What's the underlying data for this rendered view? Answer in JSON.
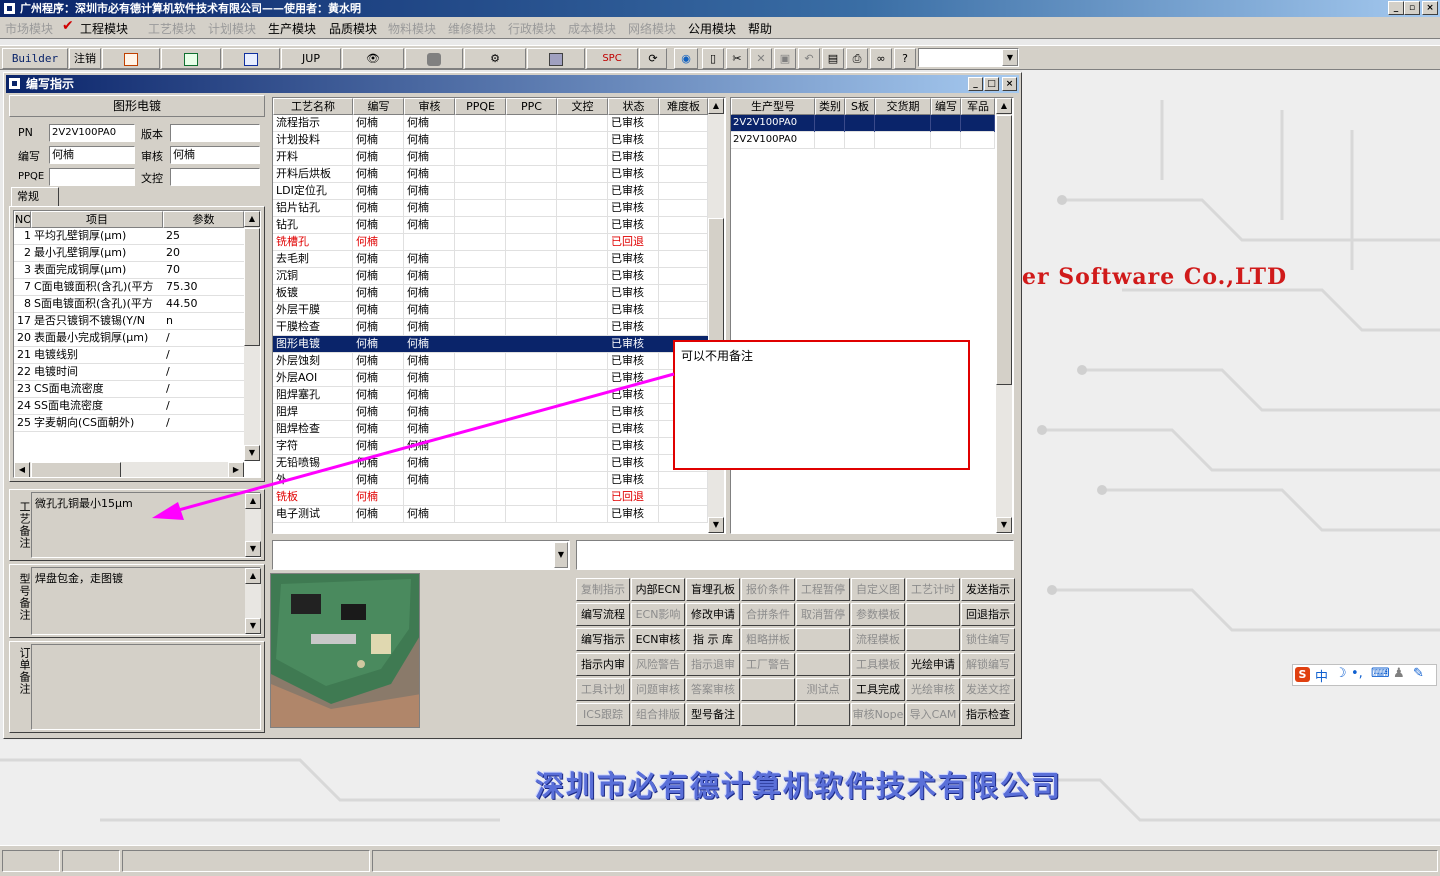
{
  "app": {
    "title": "广州程序：深圳市必有德计算机软件技术有限公司——使用者：黄水明"
  },
  "menu": {
    "items": [
      {
        "label": "市场模块",
        "enabled": false
      },
      {
        "label": "工程模块",
        "enabled": true,
        "checked": true
      },
      {
        "label": "工艺模块",
        "enabled": false
      },
      {
        "label": "计划模块",
        "enabled": false
      },
      {
        "label": "生产模块",
        "enabled": true
      },
      {
        "label": "品质模块",
        "enabled": true
      },
      {
        "label": "物料模块",
        "enabled": false
      },
      {
        "label": "维修模块",
        "enabled": false
      },
      {
        "label": "行政模块",
        "enabled": false
      },
      {
        "label": "成本模块",
        "enabled": false
      },
      {
        "label": "网络模块",
        "enabled": false
      },
      {
        "label": "公用模块",
        "enabled": true
      },
      {
        "label": "帮助",
        "enabled": true
      }
    ]
  },
  "toolbar": {
    "builder": "Builder",
    "logout": "注销",
    "jup": "JUP",
    "spc": "SPC"
  },
  "window": {
    "title": "编写指示",
    "process_name": "图形电镀",
    "form": {
      "pn_label": "PN",
      "pn_value": "2V2V100PA0",
      "version_label": "版本",
      "version_value": "",
      "author_label": "编写",
      "author_value": "何楠",
      "review_label": "审核",
      "review_value": "何楠",
      "ppqe_label": "PPQE",
      "ppqe_value": "",
      "doc_label": "文控",
      "doc_value": ""
    },
    "tab": "常规",
    "params": {
      "headers": [
        "NO",
        "项目",
        "参数"
      ],
      "rows": [
        [
          "1",
          "平均孔壁铜厚(μm)",
          "25"
        ],
        [
          "2",
          "最小孔壁铜厚(μm)",
          "20"
        ],
        [
          "3",
          "表面完成铜厚(μm)",
          "70"
        ],
        [
          "7",
          "C面电镀面积(含孔)(平方",
          "75.30"
        ],
        [
          "8",
          "S面电镀面积(含孔)(平方",
          "44.50"
        ],
        [
          "17",
          "是否只镀铜不镀锡(Y/N",
          "n"
        ],
        [
          "20",
          "表面最小完成铜厚(μm)",
          "/"
        ],
        [
          "21",
          "电镀线别",
          "/"
        ],
        [
          "22",
          "电镀时间",
          "/"
        ],
        [
          "23",
          "CS面电流密度",
          "/"
        ],
        [
          "24",
          "SS面电流密度",
          "/"
        ],
        [
          "25",
          "字麦朝向(CS面朝外)",
          "/"
        ]
      ]
    },
    "memos": {
      "process_label": "工艺备注",
      "process_text": "微孔孔铜最小15μm",
      "model_label": "型号备注",
      "model_text": "焊盘包金，走图镀",
      "order_label": "订单备注",
      "order_text": ""
    },
    "process_table": {
      "headers": [
        "工艺名称",
        "编写",
        "审核",
        "PPQE",
        "PPC",
        "文控",
        "状态",
        "难度板"
      ],
      "rows": [
        {
          "name": "流程指示",
          "author": "何楠",
          "reviewer": "何楠",
          "status": "已审核"
        },
        {
          "name": "计划投料",
          "author": "何楠",
          "reviewer": "何楠",
          "status": "已审核"
        },
        {
          "name": "开料",
          "author": "何楠",
          "reviewer": "何楠",
          "status": "已审核"
        },
        {
          "name": "开料后烘板",
          "author": "何楠",
          "reviewer": "何楠",
          "status": "已审核"
        },
        {
          "name": "LDI定位孔",
          "author": "何楠",
          "reviewer": "何楠",
          "status": "已审核"
        },
        {
          "name": "铝片钻孔",
          "author": "何楠",
          "reviewer": "何楠",
          "status": "已审核"
        },
        {
          "name": "钻孔",
          "author": "何楠",
          "reviewer": "何楠",
          "status": "已审核"
        },
        {
          "name": "铣槽孔",
          "author": "何楠",
          "reviewer": "",
          "status": "已回退",
          "returned": true
        },
        {
          "name": "去毛刺",
          "author": "何楠",
          "reviewer": "何楠",
          "status": "已审核"
        },
        {
          "name": "沉铜",
          "author": "何楠",
          "reviewer": "何楠",
          "status": "已审核"
        },
        {
          "name": "板镀",
          "author": "何楠",
          "reviewer": "何楠",
          "status": "已审核"
        },
        {
          "name": "外层干膜",
          "author": "何楠",
          "reviewer": "何楠",
          "status": "已审核"
        },
        {
          "name": "干膜检查",
          "author": "何楠",
          "reviewer": "何楠",
          "status": "已审核"
        },
        {
          "name": "图形电镀",
          "author": "何楠",
          "reviewer": "何楠",
          "status": "已审核",
          "selected": true
        },
        {
          "name": "外层蚀刻",
          "author": "何楠",
          "reviewer": "何楠",
          "status": "已审核"
        },
        {
          "name": "外层AOI",
          "author": "何楠",
          "reviewer": "何楠",
          "status": "已审核"
        },
        {
          "name": "阻焊塞孔",
          "author": "何楠",
          "reviewer": "何楠",
          "status": "已审核"
        },
        {
          "name": "阻焊",
          "author": "何楠",
          "reviewer": "何楠",
          "status": "已审核"
        },
        {
          "name": "阻焊检查",
          "author": "何楠",
          "reviewer": "何楠",
          "status": "已审核"
        },
        {
          "name": "字符",
          "author": "何楠",
          "reviewer": "何楠",
          "status": "已审核"
        },
        {
          "name": "无铅喷锡",
          "author": "何楠",
          "reviewer": "何楠",
          "status": "已审核"
        },
        {
          "name": "外",
          "author": "何楠",
          "reviewer": "何楠",
          "status": "已审核"
        },
        {
          "name": "铣板",
          "author": "何楠",
          "reviewer": "",
          "status": "已回退",
          "returned": true
        },
        {
          "name": "电子测试",
          "author": "何楠",
          "reviewer": "何楠",
          "status": "已审核"
        }
      ]
    },
    "model_table": {
      "headers": [
        "生产型号",
        "类别",
        "S板",
        "交货期",
        "编写",
        "军品"
      ],
      "rows": [
        {
          "model": "2V2V100PA0",
          "selected": true
        },
        {
          "model": "2V2V100PA0",
          "selected": false
        }
      ]
    },
    "buttons": [
      [
        {
          "l": "复制指示",
          "e": false
        },
        {
          "l": "内部ECN",
          "e": true
        },
        {
          "l": "盲埋孔板",
          "e": true
        },
        {
          "l": "报价条件",
          "e": false
        },
        {
          "l": "工程暂停",
          "e": false
        },
        {
          "l": "自定义图",
          "e": false
        },
        {
          "l": "工艺计时",
          "e": false
        },
        {
          "l": "发送指示",
          "e": true
        }
      ],
      [
        {
          "l": "编写流程",
          "e": true
        },
        {
          "l": "ECN影响",
          "e": false
        },
        {
          "l": "修改申请",
          "e": true
        },
        {
          "l": "合拼条件",
          "e": false
        },
        {
          "l": "取消暂停",
          "e": false
        },
        {
          "l": "参数模板",
          "e": false
        },
        {
          "l": "",
          "e": false
        },
        {
          "l": "回退指示",
          "e": true
        }
      ],
      [
        {
          "l": "编写指示",
          "e": true
        },
        {
          "l": "ECN审核",
          "e": true
        },
        {
          "l": "指 示 库",
          "e": true
        },
        {
          "l": "粗略拼板",
          "e": false
        },
        {
          "l": "",
          "e": false
        },
        {
          "l": "流程模板",
          "e": false
        },
        {
          "l": "",
          "e": false
        },
        {
          "l": "锁住编写",
          "e": false
        }
      ],
      [
        {
          "l": "指示内审",
          "e": true
        },
        {
          "l": "风险警告",
          "e": false
        },
        {
          "l": "指示退审",
          "e": false
        },
        {
          "l": "工厂警告",
          "e": false
        },
        {
          "l": "",
          "e": false
        },
        {
          "l": "工具模板",
          "e": false
        },
        {
          "l": "光绘申请",
          "e": true
        },
        {
          "l": "解锁编写",
          "e": false
        }
      ],
      [
        {
          "l": "工具计划",
          "e": false
        },
        {
          "l": "问题审核",
          "e": false
        },
        {
          "l": "答案审核",
          "e": false
        },
        {
          "l": "",
          "e": false
        },
        {
          "l": "测试点",
          "e": false
        },
        {
          "l": "工具完成",
          "e": true
        },
        {
          "l": "光绘审核",
          "e": false
        },
        {
          "l": "发送文控",
          "e": false
        }
      ],
      [
        {
          "l": "ICS跟踪",
          "e": false
        },
        {
          "l": "组合排版",
          "e": false
        },
        {
          "l": "型号备注",
          "e": true
        },
        {
          "l": "",
          "e": false
        },
        {
          "l": "",
          "e": false
        },
        {
          "l": "审核Nope",
          "e": false
        },
        {
          "l": "导入CAM",
          "e": false
        },
        {
          "l": "指示检查",
          "e": true
        }
      ]
    ]
  },
  "annotation": {
    "text": "可以不用备注",
    "color": "#ff00ff",
    "box_color": "#e00000"
  },
  "desktop": {
    "software_text": "er Software Co.,LTD",
    "company_text": "深圳市必有德计算机软件技术有限公司"
  },
  "ime": {
    "lang": "中"
  }
}
